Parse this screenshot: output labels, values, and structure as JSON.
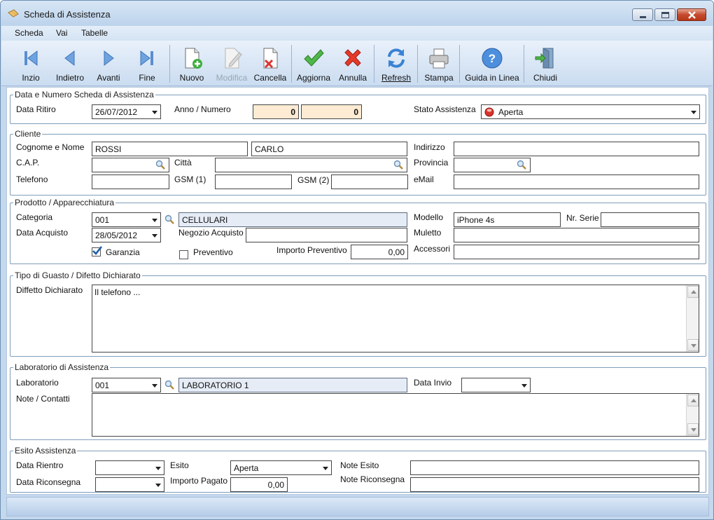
{
  "window": {
    "title": "Scheda di Assistenza"
  },
  "menu": [
    "Scheda",
    "Vai",
    "Tabelle"
  ],
  "toolbar": {
    "inizio": "Inzio",
    "indietro": "Indietro",
    "avanti": "Avanti",
    "fine": "Fine",
    "nuovo": "Nuovo",
    "modifica": "Modifica",
    "cancella": "Cancella",
    "aggiorna": "Aggiorna",
    "annulla": "Annulla",
    "refresh": "Refresh",
    "stampa": "Stampa",
    "guida": "Guida in Linea",
    "chiudi": "Chiudi"
  },
  "scheda": {
    "title": "Data e Numero Scheda di Assistenza",
    "data_ritiro_label": "Data Ritiro",
    "data_ritiro": "26/07/2012",
    "anno_numero_label": "Anno / Numero",
    "anno": "0",
    "numero": "0",
    "stato_label": "Stato Assistenza",
    "stato": "Aperta",
    "stato_color": "#d8322a"
  },
  "cliente": {
    "title": "Cliente",
    "cognome_nome_label": "Cognome e Nome",
    "cognome": "ROSSI",
    "nome": "CARLO",
    "indirizzo_label": "Indirizzo",
    "indirizzo": "",
    "cap_label": "C.A.P.",
    "cap": "",
    "citta_label": "Città",
    "citta": "",
    "provincia_label": "Provincia",
    "provincia": "",
    "telefono_label": "Telefono",
    "telefono": "",
    "gsm1_label": "GSM (1)",
    "gsm1": "",
    "gsm2_label": "GSM (2)",
    "gsm2": "",
    "email_label": "eMail",
    "email": ""
  },
  "prodotto": {
    "title": "Prodotto / Apparecchiatura",
    "categoria_label": "Categoria",
    "categoria_code": "001",
    "categoria_name": "CELLULARI",
    "modello_label": "Modello",
    "modello": "iPhone 4s",
    "serie_label": "Nr. Serie",
    "serie": "",
    "data_acquisto_label": "Data Acquisto",
    "data_acquisto": "28/05/2012",
    "negozio_label": "Negozio Acquisto",
    "negozio": "",
    "muletto_label": "Muletto",
    "muletto": "",
    "garanzia_label": "Garanzia",
    "garanzia_checked": true,
    "preventivo_label": "Preventivo",
    "preventivo_checked": false,
    "importo_prev_label": "Importo Preventivo",
    "importo_prev": "0,00",
    "accessori_label": "Accessori",
    "accessori": ""
  },
  "guasto": {
    "title": "Tipo di Guasto / Difetto Dichiarato",
    "difetto_label": "Diffetto Dichiarato",
    "difetto": "Il telefono ..."
  },
  "laboratorio": {
    "title": "Laboratorio di Assistenza",
    "lab_label": "Laboratorio",
    "lab_code": "001",
    "lab_name": "LABORATORIO 1",
    "data_invio_label": "Data Invio",
    "data_invio": "",
    "note_label": "Note / Contatti",
    "note": ""
  },
  "esito": {
    "title": "Esito Assistenza",
    "data_rientro_label": "Data Rientro",
    "data_rientro": "",
    "data_riconsegna_label": "Data Riconsegna",
    "data_riconsegna": "",
    "esito_label": "Esito",
    "esito": "Aperta",
    "importo_label": "Importo Pagato",
    "importo": "0,00",
    "note_esito_label": "Note Esito",
    "note_esito": "",
    "note_riconsegna_label": "Note Riconsegna",
    "note_riconsegna": ""
  }
}
